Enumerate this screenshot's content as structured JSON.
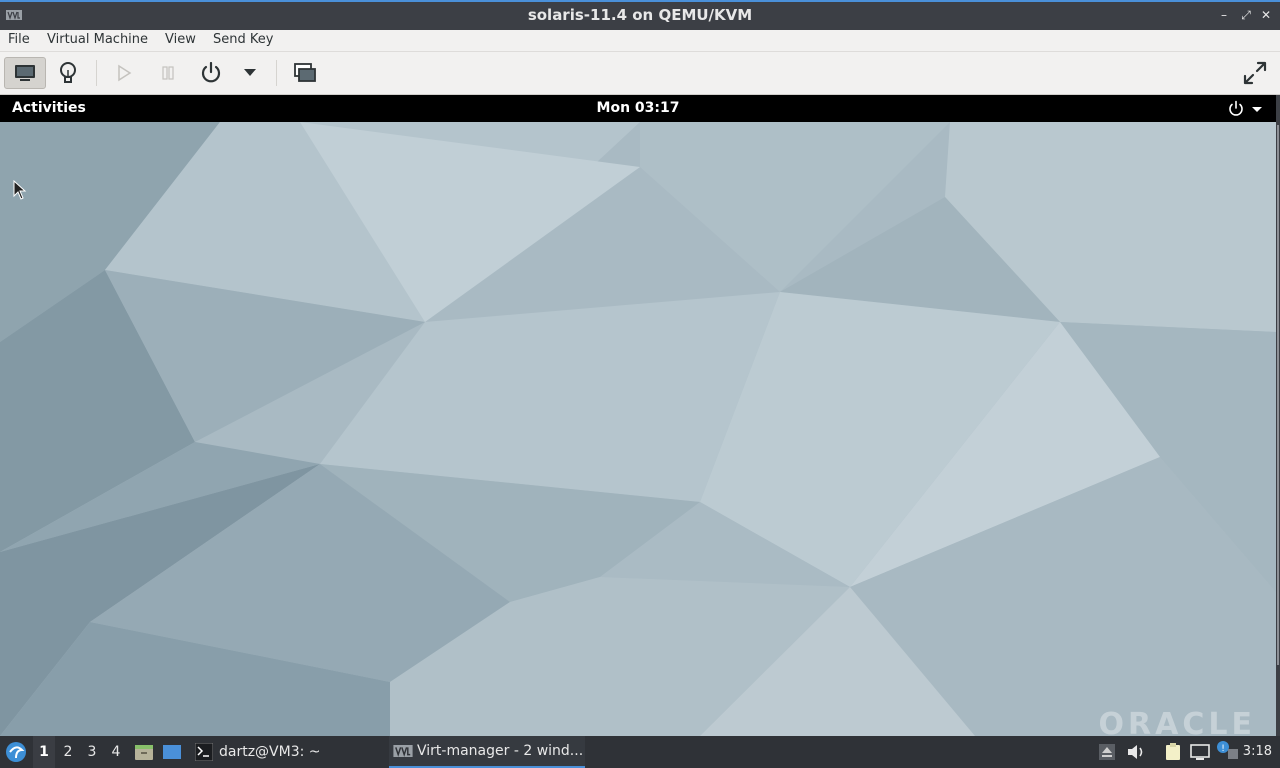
{
  "window": {
    "title": "solaris-11.4 on QEMU/KVM",
    "app_icon": "virt-manager-icon",
    "controls": [
      "minimize-icon",
      "maximize-icon",
      "close-icon"
    ]
  },
  "menubar": {
    "items": [
      "File",
      "Virtual Machine",
      "View",
      "Send Key"
    ]
  },
  "toolbar": {
    "buttons": [
      {
        "name": "console-view-button",
        "icon": "monitor-icon",
        "active": true
      },
      {
        "name": "details-view-button",
        "icon": "lightbulb-icon",
        "active": false
      },
      {
        "name": "run-button",
        "icon": "play-icon",
        "enabled": false
      },
      {
        "name": "pause-button",
        "icon": "pause-icon",
        "enabled": false
      },
      {
        "name": "shutdown-button",
        "icon": "power-icon",
        "enabled": true
      },
      {
        "name": "shutdown-menu-button",
        "icon": "chevron-down-icon",
        "enabled": true
      },
      {
        "name": "snapshots-button",
        "icon": "snapshots-icon",
        "enabled": true
      },
      {
        "name": "fullscreen-button",
        "icon": "fullscreen-icon",
        "enabled": true
      }
    ]
  },
  "guest": {
    "activities": "Activities",
    "clock": "Mon 03:17",
    "sysmenu_icons": [
      "power-icon",
      "chevron-down-icon"
    ],
    "watermark": "ORACLE"
  },
  "taskbar": {
    "workspaces": [
      "1",
      "2",
      "3",
      "4"
    ],
    "active_workspace": "1",
    "tasks": [
      {
        "label": "dartz@VM3: ~",
        "icon": "terminal-icon",
        "active": false
      },
      {
        "label": "Virt-manager - 2 wind...",
        "icon": "virt-manager-icon",
        "active": true
      }
    ],
    "clock": "3:18",
    "tray_icons": [
      "eject-icon",
      "volume-icon",
      "clipboard-icon",
      "network-icon",
      "notification-icon"
    ]
  },
  "colors": {
    "accent": "#4a90d9",
    "titlebar": "#3c3f45",
    "taskbar": "#2f3237",
    "wallpaper": "#a9bac3"
  }
}
